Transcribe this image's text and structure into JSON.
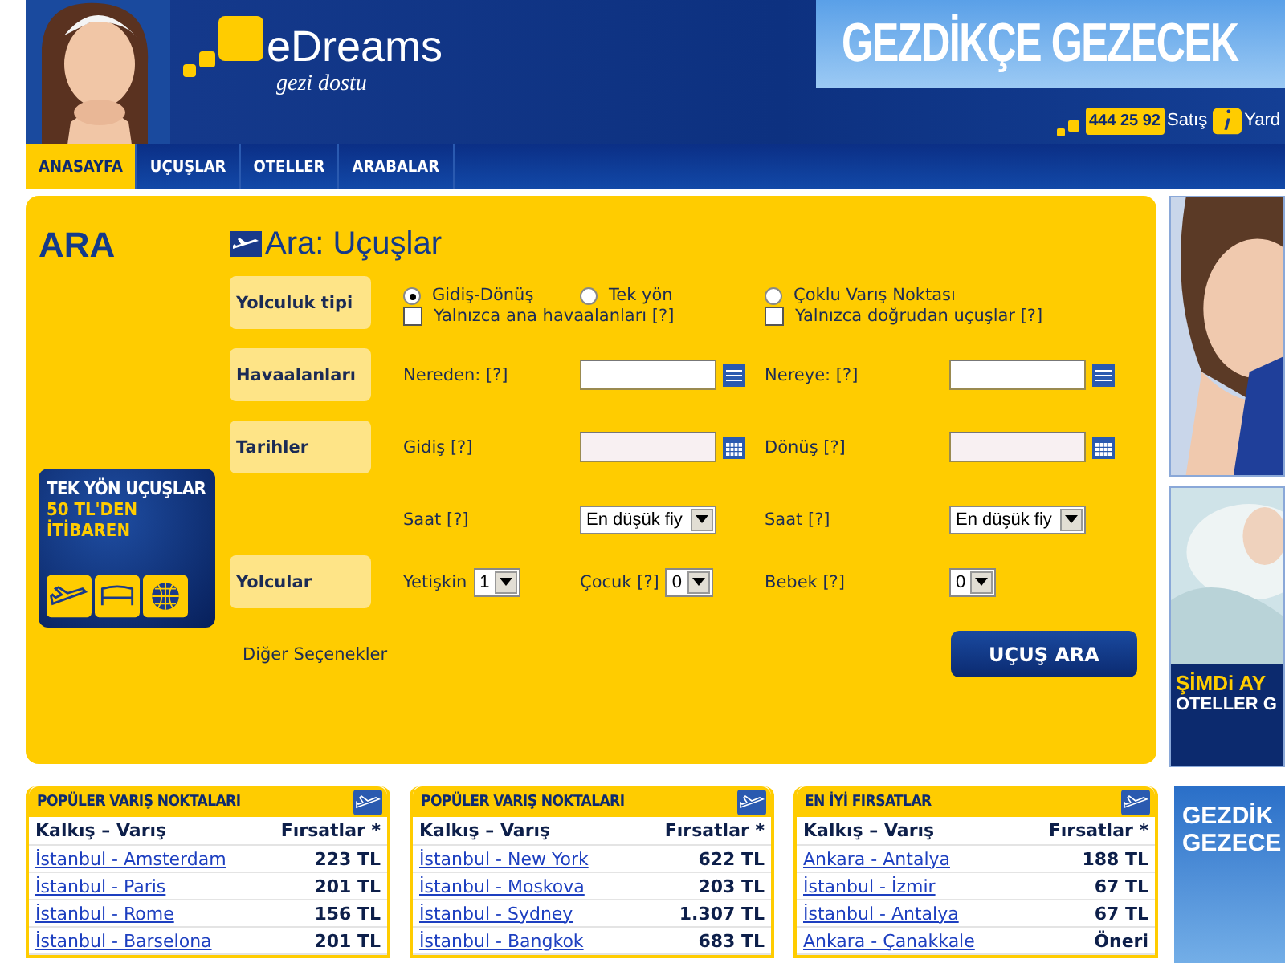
{
  "header": {
    "logo": "eDreams",
    "tagline": "gezi dostu",
    "banner": "GEZDİKÇE GEZECEK",
    "phone": "444 25 92",
    "phone_label": "Satış",
    "help_label": "Yard"
  },
  "nav": [
    {
      "label": "ANASAYFA",
      "selected": true
    },
    {
      "label": "UÇUŞLAR",
      "selected": false
    },
    {
      "label": "OTELLER",
      "selected": false
    },
    {
      "label": "ARABALAR",
      "selected": false
    }
  ],
  "search": {
    "heading": "ARA",
    "promo": [
      "TEK YÖN UÇUŞLAR",
      "50 TL'DEN",
      "İTİBAREN"
    ],
    "title": "Ara: Uçuşlar",
    "trip_type": {
      "label": "Yolculuk tipi",
      "options": [
        {
          "label": "Gidiş-Dönüş",
          "selected": true
        },
        {
          "label": "Tek yön",
          "selected": false
        },
        {
          "label": "Çoklu Varış Noktası",
          "selected": false
        }
      ],
      "checkboxes": [
        {
          "label": "Yalnızca ana havaalanları [?]",
          "checked": false
        },
        {
          "label": "Yalnızca doğrudan uçuşlar [?]",
          "checked": false
        }
      ]
    },
    "airports": {
      "label": "Havaalanları",
      "from_label": "Nereden: [?]",
      "to_label": "Nereye: [?]"
    },
    "dates": {
      "label": "Tarihler",
      "depart_label": "Gidiş [?]",
      "return_label": "Dönüş [?]",
      "depart_time_label": "Saat [?]",
      "depart_time": "En düşük fiy",
      "return_time_label": "Saat [?]",
      "return_time": "En düşük fiy"
    },
    "passengers": {
      "label": "Yolcular",
      "adult_label": "Yetişkin",
      "adult": "1",
      "child_label": "Çocuk [?]",
      "child": "0",
      "infant_label": "Bebek [?]",
      "infant": "0"
    },
    "more_options": "Diğer Seçenekler",
    "submit": "UÇUŞ ARA"
  },
  "side_ads": [
    {
      "kind": "picture"
    },
    {
      "kind": "promo",
      "lines": [
        "ŞİMDi AY",
        "OTELLER G"
      ]
    },
    {
      "kind": "promo",
      "lines": [
        "GEZDİK",
        "GEZECE"
      ]
    }
  ],
  "panels": [
    {
      "title": "POPÜLER VARIŞ NOKTALARI",
      "columns": [
        "Kalkış – Varış",
        "Fırsatlar *"
      ],
      "rows": [
        {
          "route": "İstanbul - Amsterdam",
          "price": "223 TL"
        },
        {
          "route": "İstanbul - Paris",
          "price": "201 TL"
        },
        {
          "route": "İstanbul - Rome",
          "price": "156 TL"
        },
        {
          "route": "İstanbul - Barselona",
          "price": "201 TL"
        }
      ]
    },
    {
      "title": "POPÜLER VARIŞ NOKTALARI",
      "columns": [
        "Kalkış – Varış",
        "Fırsatlar *"
      ],
      "rows": [
        {
          "route": "İstanbul - New York",
          "price": "622 TL"
        },
        {
          "route": "İstanbul - Moskova",
          "price": "203 TL"
        },
        {
          "route": "İstanbul - Sydney",
          "price": "1.307 TL"
        },
        {
          "route": "İstanbul - Bangkok",
          "price": "683 TL"
        }
      ]
    },
    {
      "title": "EN İYİ FIRSATLAR",
      "columns": [
        "Kalkış – Varış",
        "Fırsatlar *"
      ],
      "rows": [
        {
          "route": "Ankara - Antalya",
          "price": "188 TL"
        },
        {
          "route": "İstanbul - İzmir",
          "price": "67 TL"
        },
        {
          "route": "İstanbul - Antalya",
          "price": "67 TL"
        },
        {
          "route": "Ankara - Çanakkale",
          "price": "Öneri"
        }
      ]
    }
  ]
}
